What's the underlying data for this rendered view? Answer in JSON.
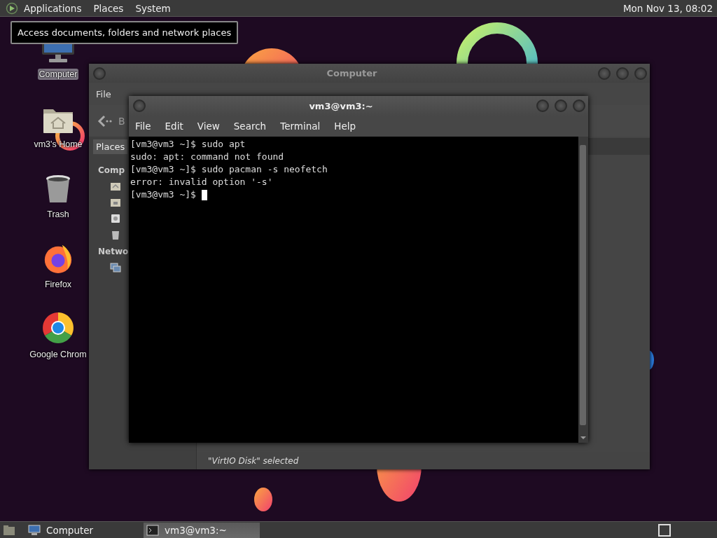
{
  "top_panel": {
    "menus": [
      {
        "label": "Applications"
      },
      {
        "label": "Places"
      },
      {
        "label": "System"
      }
    ],
    "clock": "Mon Nov 13, 08:02"
  },
  "tooltip": "Access documents, folders and network places",
  "desktop_icons": [
    {
      "kind": "computer",
      "label": "Computer",
      "selected": true
    },
    {
      "kind": "home",
      "label": "vm3's Home",
      "selected": false
    },
    {
      "kind": "trash",
      "label": "Trash",
      "selected": false
    },
    {
      "kind": "firefox",
      "label": "Firefox",
      "selected": false
    },
    {
      "kind": "chrome",
      "label": "Google Chrom",
      "selected": false
    }
  ],
  "file_manager": {
    "title": "Computer",
    "menu": [
      "File"
    ],
    "back_label": "B",
    "places_button": "Places",
    "sidebar": [
      {
        "heading": "Comp",
        "items": [
          {
            "kind": "home"
          },
          {
            "kind": "desktop"
          },
          {
            "kind": "disk"
          },
          {
            "kind": "trash"
          }
        ]
      },
      {
        "heading": "Netwo",
        "items": [
          {
            "kind": "network"
          }
        ]
      }
    ],
    "status": "\"VirtIO Disk\" selected"
  },
  "terminal": {
    "title": "vm3@vm3:~",
    "menu": [
      "File",
      "Edit",
      "View",
      "Search",
      "Terminal",
      "Help"
    ],
    "lines": [
      "[vm3@vm3 ~]$ sudo apt",
      "sudo: apt: command not found",
      "[vm3@vm3 ~]$ sudo pacman -s neofetch",
      "error: invalid option '-s'",
      "[vm3@vm3 ~]$ "
    ]
  },
  "taskbar": {
    "tasks": [
      {
        "label": "Computer",
        "selected": false
      },
      {
        "label": "vm3@vm3:~",
        "selected": true
      }
    ]
  }
}
